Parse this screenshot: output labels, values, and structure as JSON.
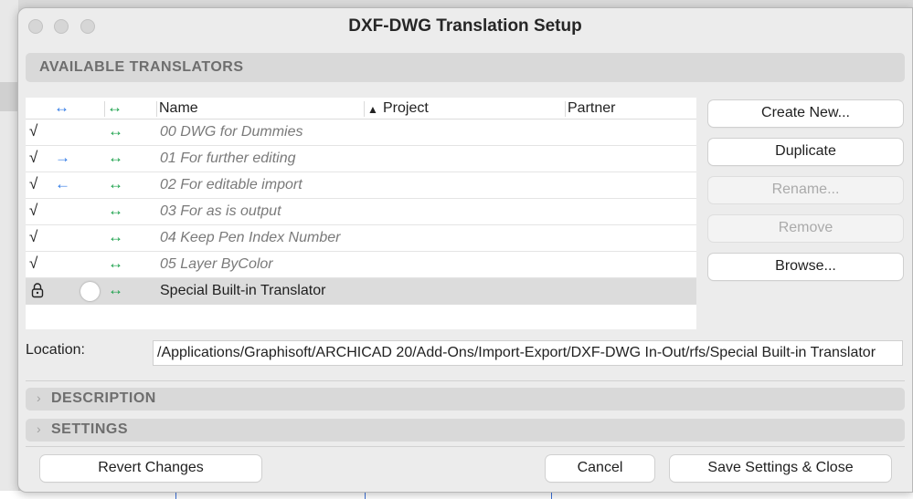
{
  "window": {
    "title": "DXF-DWG Translation Setup"
  },
  "sections": {
    "available": "AVAILABLE TRANSLATORS",
    "description": "DESCRIPTION",
    "settings": "SETTINGS"
  },
  "list": {
    "headers": {
      "direction_icon": "↔",
      "bidir_icon": "↔",
      "name": "Name",
      "project_sort": "▲",
      "project": "Project",
      "partner": "Partner"
    },
    "rows": [
      {
        "check": "√",
        "dir": "",
        "bi": "↔",
        "name": "00 DWG for Dummies"
      },
      {
        "check": "√",
        "dir": "→",
        "bi": "↔",
        "name": "01 For further editing"
      },
      {
        "check": "√",
        "dir": "←",
        "bi": "↔",
        "name": "02 For editable import"
      },
      {
        "check": "√",
        "dir": "",
        "bi": "↔",
        "name": "03 For as is output"
      },
      {
        "check": "√",
        "dir": "",
        "bi": "↔",
        "name": "04 Keep Pen Index Number"
      },
      {
        "check": "√",
        "dir": "",
        "bi": "↔",
        "name": "05 Layer ByColor"
      },
      {
        "bi": "↔",
        "name": "Special Built-in Translator",
        "selected": true,
        "locked": true
      }
    ]
  },
  "side_buttons": {
    "create_new": "Create New...",
    "duplicate": "Duplicate",
    "rename": "Rename...",
    "remove": "Remove",
    "browse": "Browse..."
  },
  "location": {
    "label": "Location:",
    "value": "/Applications/Graphisoft/ARCHICAD 20/Add-Ons/Import-Export/DXF-DWG In-Out/rfs/Special Built-in Translator"
  },
  "footer": {
    "revert": "Revert Changes",
    "cancel": "Cancel",
    "save": "Save Settings & Close"
  },
  "icons": {
    "chevron": "›"
  },
  "colors": {
    "direction_blue": "#2f7ae5",
    "bidir_green": "#1aa04a"
  }
}
